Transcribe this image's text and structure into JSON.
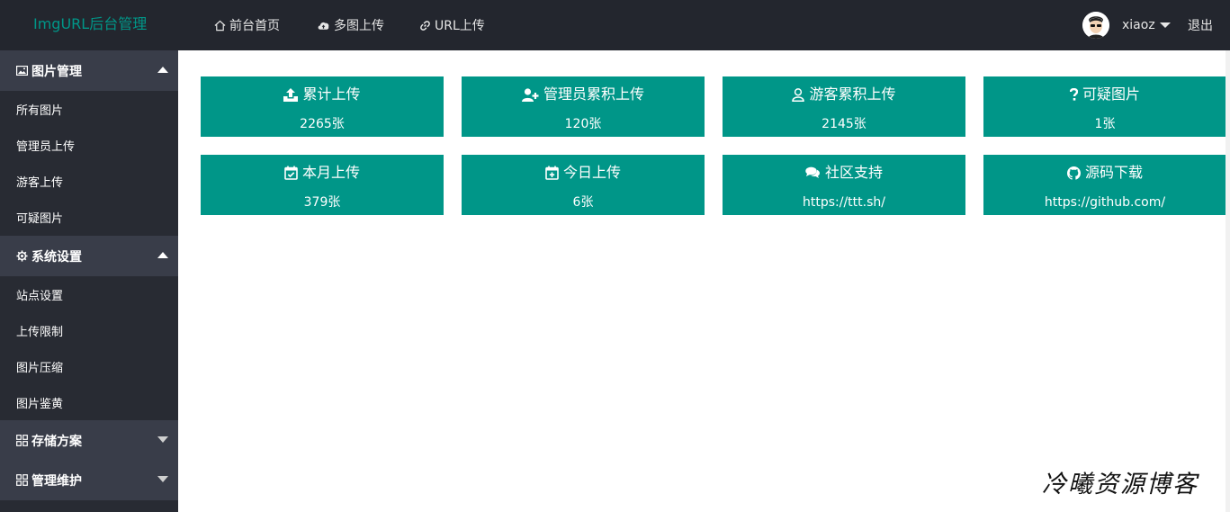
{
  "header": {
    "logo": "ImgURL后台管理",
    "nav": [
      {
        "label": "前台首页",
        "icon": "home-icon"
      },
      {
        "label": "多图上传",
        "icon": "cloud-upload-icon"
      },
      {
        "label": "URL上传",
        "icon": "link-icon"
      }
    ],
    "username": "xiaoz",
    "logout": "退出"
  },
  "sidebar": {
    "sections": [
      {
        "label": "图片管理",
        "icon": "image-icon",
        "expanded": true,
        "items": [
          "所有图片",
          "管理员上传",
          "游客上传",
          "可疑图片"
        ]
      },
      {
        "label": "系统设置",
        "icon": "gear-icon",
        "expanded": true,
        "items": [
          "站点设置",
          "上传限制",
          "图片压缩",
          "图片鉴黄"
        ]
      },
      {
        "label": "存储方案",
        "icon": "apps-icon",
        "expanded": false,
        "items": []
      },
      {
        "label": "管理维护",
        "icon": "apps-icon",
        "expanded": false,
        "items": []
      }
    ]
  },
  "cards": [
    {
      "title": "累计上传",
      "value": "2265张",
      "icon": "upload-icon"
    },
    {
      "title": "管理员累积上传",
      "value": "120张",
      "icon": "user-plus-icon"
    },
    {
      "title": "游客累积上传",
      "value": "2145张",
      "icon": "user-icon"
    },
    {
      "title": "可疑图片",
      "value": "1张",
      "icon": "question-icon"
    },
    {
      "title": "本月上传",
      "value": "379张",
      "icon": "calendar-check-icon"
    },
    {
      "title": "今日上传",
      "value": "6张",
      "icon": "calendar-plus-icon"
    },
    {
      "title": "社区支持",
      "value": "https://ttt.sh/",
      "icon": "comments-icon"
    },
    {
      "title": "源码下载",
      "value": "https://github.com/",
      "icon": "github-icon"
    }
  ],
  "watermark": "冷曦资源博客",
  "colors": {
    "accent": "#009688",
    "topbar": "#23262e",
    "sidebar": "#282b33",
    "sidebar_header": "#393d49"
  }
}
